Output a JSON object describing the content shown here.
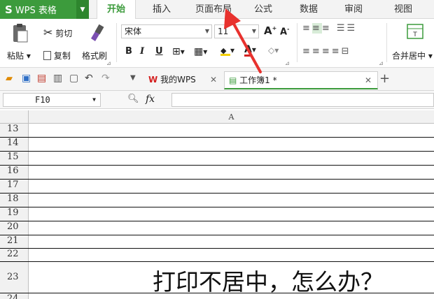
{
  "app": {
    "name": "WPS 表格",
    "logo": "S"
  },
  "menu": {
    "items": [
      "开始",
      "插入",
      "页面布局",
      "公式",
      "数据",
      "审阅",
      "视图"
    ],
    "active": "开始"
  },
  "ribbon": {
    "paste_label": "粘贴",
    "cut_label": "剪切",
    "copy_label": "复制",
    "format_painter_label": "格式刷",
    "font_name": "宋体",
    "font_size": "11",
    "font_grow": "A",
    "font_shrink": "A",
    "bold": "B",
    "italic": "I",
    "underline": "U",
    "font_color_letter": "A",
    "merge_center_label": "合并居中"
  },
  "tabs": [
    {
      "label": "我的WPS",
      "icon": "wps-logo-icon"
    },
    {
      "label": "工作簿1 *",
      "icon": "spreadsheet-icon"
    }
  ],
  "formula_bar": {
    "cell_ref": "F10",
    "fx_label": "fx"
  },
  "grid": {
    "column_header": "A",
    "rows": [
      "13",
      "14",
      "15",
      "16",
      "17",
      "18",
      "19",
      "20",
      "21",
      "22",
      "23",
      "24"
    ],
    "cell_text": "打印不居中，怎么办？"
  },
  "annotation": {
    "arrow_color": "#e8322e"
  },
  "colors": {
    "accent": "#3c9b3c",
    "arrow": "#e8322e"
  }
}
